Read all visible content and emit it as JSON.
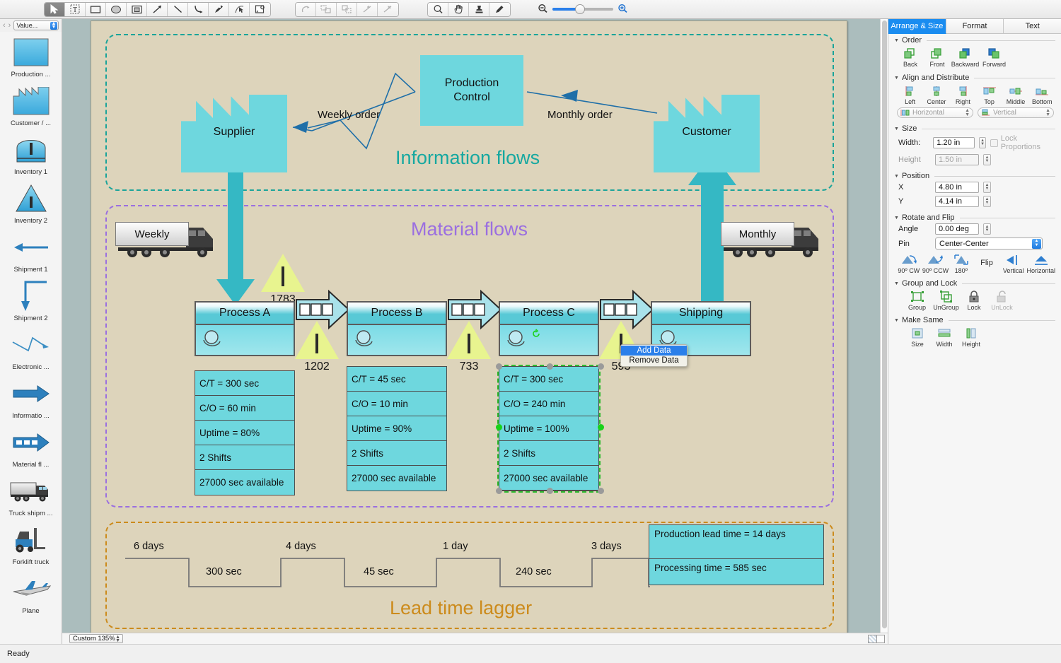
{
  "toolbar": {
    "tools": [
      {
        "name": "select-tool",
        "icon": "arrow-cursor",
        "selected": true
      },
      {
        "name": "text-tool",
        "icon": "text-box",
        "selected": false
      },
      {
        "name": "rectangle-tool",
        "icon": "rectangle",
        "selected": false
      },
      {
        "name": "ellipse-tool",
        "icon": "ellipse",
        "selected": false
      },
      {
        "name": "frame-tool",
        "icon": "nested-rectangle",
        "selected": false
      },
      {
        "name": "arrow-line-tool",
        "icon": "diagonal-arrow",
        "selected": false
      },
      {
        "name": "line-tool",
        "icon": "diagonal-line",
        "selected": false
      },
      {
        "name": "curve-tool",
        "icon": "curved-line",
        "selected": false
      },
      {
        "name": "pen-tool",
        "icon": "pen",
        "selected": false
      },
      {
        "name": "node-edit-tool",
        "icon": "node-edit",
        "selected": false
      },
      {
        "name": "callout-tool",
        "icon": "callout-page",
        "selected": false
      }
    ],
    "edit_tools": [
      {
        "name": "undo-curve-tool",
        "icon": "rotate-arrow"
      },
      {
        "name": "connect-shapes-tool",
        "icon": "connect-shapes"
      },
      {
        "name": "break-shapes-tool",
        "icon": "break-shapes"
      },
      {
        "name": "add-point-tool",
        "icon": "add-point"
      },
      {
        "name": "delete-point-tool",
        "icon": "delete-point"
      }
    ],
    "view_tools": [
      {
        "name": "zoom-tool",
        "icon": "magnifier"
      },
      {
        "name": "hand-tool",
        "icon": "hand"
      },
      {
        "name": "stamp-tool",
        "icon": "stamp"
      },
      {
        "name": "eyedropper-tool",
        "icon": "eyedropper"
      }
    ],
    "zoom_out_icon": "zoom-out-magnifier",
    "zoom_in_icon": "zoom-in-magnifier"
  },
  "stencil": {
    "nav_prev": "‹",
    "nav_next": "›",
    "selector_value": "Value...",
    "items": [
      {
        "label": "Production ...",
        "icon": "process-rectangle"
      },
      {
        "label": "Customer / ...",
        "icon": "factory"
      },
      {
        "label": "Inventory 1",
        "icon": "inventory-dome"
      },
      {
        "label": "Inventory 2",
        "icon": "inventory-triangle"
      },
      {
        "label": "Shipment 1",
        "icon": "left-arrow"
      },
      {
        "label": "Shipment 2",
        "icon": "elbow-down-arrow"
      },
      {
        "label": "Electronic  ...",
        "icon": "zigzag-arrow"
      },
      {
        "label": "Informatio ...",
        "icon": "solid-right-arrow"
      },
      {
        "label": "Material fl ...",
        "icon": "dashed-push-arrow"
      },
      {
        "label": "Truck shipm ...",
        "icon": "truck"
      },
      {
        "label": "Forklift truck",
        "icon": "forklift"
      },
      {
        "label": "Plane",
        "icon": "airplane"
      }
    ]
  },
  "diagram": {
    "zones": [
      {
        "title": "Information flows",
        "color": "#16a8a0"
      },
      {
        "title": "Material flows",
        "color": "#9b6fe0"
      },
      {
        "title": "Lead time lagger",
        "color": "#cc8b1c"
      }
    ],
    "nodes": {
      "supplier": "Supplier",
      "customer": "Customer",
      "production_control_line1": "Production",
      "production_control_line2": "Control"
    },
    "order_labels": {
      "weekly": "Weekly order",
      "monthly": "Monthly order"
    },
    "trucks": [
      {
        "label": "Weekly"
      },
      {
        "label": "Monthly"
      }
    ],
    "inventories": [
      {
        "value": "1783"
      },
      {
        "value": "1202"
      },
      {
        "value": "733"
      },
      {
        "value": "593"
      }
    ],
    "processes": [
      {
        "name": "Process A",
        "data": [
          "C/T = 300 sec",
          "C/O = 60 min",
          "Uptime = 80%",
          "2 Shifts",
          "27000 sec available"
        ],
        "selected": false
      },
      {
        "name": "Process B",
        "data": [
          "C/T = 45 sec",
          "C/O = 10 min",
          "Uptime = 90%",
          "2 Shifts",
          "27000 sec available"
        ],
        "selected": false
      },
      {
        "name": "Process C",
        "data": [
          "C/T = 300 sec",
          "C/O = 240 min",
          "Uptime = 100%",
          "2 Shifts",
          "27000 sec available"
        ],
        "selected": true
      },
      {
        "name": "Shipping",
        "data": [],
        "selected": false
      }
    ],
    "leadtime": {
      "upper": [
        "6 days",
        "4 days",
        "1 day",
        "3 days"
      ],
      "lower": [
        "300 sec",
        "45 sec",
        "240 sec"
      ],
      "summary": [
        "Production lead time = 14 days",
        "Processing time = 585 sec"
      ]
    }
  },
  "context_menu": {
    "items": [
      {
        "label": "Add Data",
        "highlighted": true
      },
      {
        "label": "Remove Data",
        "highlighted": false
      }
    ]
  },
  "inspector": {
    "tabs": [
      {
        "label": "Arrange & Size",
        "active": true
      },
      {
        "label": "Format",
        "active": false
      },
      {
        "label": "Text",
        "active": false
      }
    ],
    "order": {
      "title": "Order",
      "buttons": [
        "Back",
        "Front",
        "Backward",
        "Forward"
      ]
    },
    "align": {
      "title": "Align and Distribute",
      "buttons": [
        "Left",
        "Center",
        "Right",
        "Top",
        "Middle",
        "Bottom"
      ],
      "distribute": [
        "Horizontal",
        "Vertical"
      ]
    },
    "size": {
      "title": "Size",
      "width_label": "Width:",
      "width_value": "1.20 in",
      "height_label": "Height",
      "height_value": "1.50 in",
      "lock_label": "Lock Proportions"
    },
    "position": {
      "title": "Position",
      "x_label": "X",
      "x_value": "4.80 in",
      "y_label": "Y",
      "y_value": "4.14 in"
    },
    "rotate": {
      "title": "Rotate and Flip",
      "angle_label": "Angle",
      "angle_value": "0.00 deg",
      "pin_label": "Pin",
      "pin_value": "Center-Center",
      "buttons": [
        "90º CW",
        "90º CCW",
        "180º"
      ],
      "flip_label": "Flip",
      "flip_buttons": [
        "Vertical",
        "Horizontal"
      ]
    },
    "group": {
      "title": "Group and Lock",
      "buttons": [
        "Group",
        "UnGroup",
        "Lock",
        "UnLock"
      ]
    },
    "makesame": {
      "title": "Make Same",
      "buttons": [
        "Size",
        "Width",
        "Height"
      ]
    }
  },
  "statusbar": {
    "message": "Ready",
    "zoom_value": "Custom 135%"
  },
  "colors": {
    "accent_blue": "#1a8cf0",
    "teal_zone": "#16a8a0",
    "purple_zone": "#9b6fe0",
    "orange_zone": "#cc8b1c",
    "shape_cyan": "#6ed7de",
    "inventory_yellow": "#e8f48f",
    "page_bg": "#ddd4bb"
  }
}
